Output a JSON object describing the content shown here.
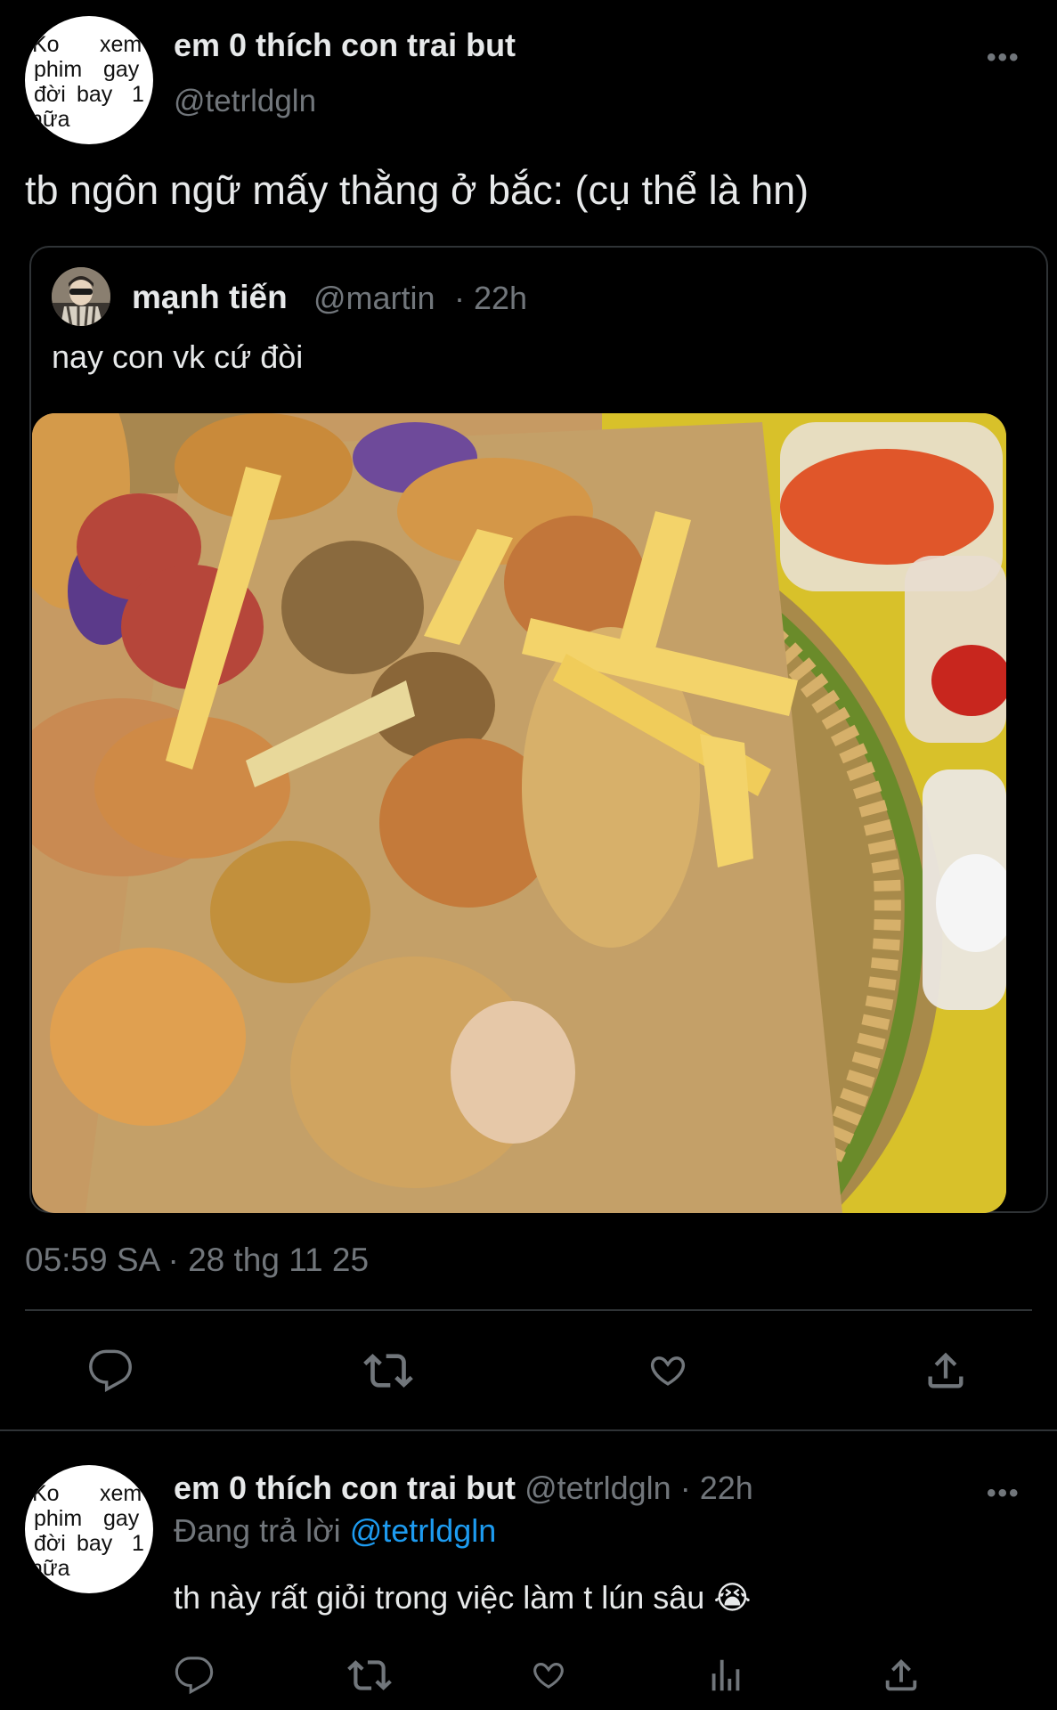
{
  "main_tweet": {
    "author_name": "em 0 thích con trai but",
    "author_handle": "@tetrldgln",
    "avatar_words": [
      "Ko",
      "xem",
      "phim",
      "gay",
      "đời",
      "bay",
      "1",
      "nữa"
    ],
    "more_label": "•••",
    "text": "tb ngôn ngữ mấy thằng ở bắc: (cụ thể là hn)",
    "timestamp": "05:59 SA · 28 thg 11 25"
  },
  "quoted_tweet": {
    "author_name": "mạnh tiến",
    "author_handle": "@martin",
    "time": "· 22h",
    "text": "nay con vk cứ đòi"
  },
  "actions": {
    "icons": [
      "reply-icon",
      "retweet-icon",
      "like-icon",
      "share-icon"
    ]
  },
  "reply_tweet": {
    "author_name": "em 0 thích con trai but",
    "author_handle": "@tetrldgln",
    "time": "· 22h",
    "more_label": "•••",
    "replying_prefix": "Đang trả lời",
    "replying_to": "@tetrldgln",
    "text": "th này rất giỏi trong việc làm t lún sâu",
    "emoji": "😭",
    "icons": [
      "reply-icon",
      "retweet-icon",
      "like-icon",
      "analytics-icon",
      "share-icon"
    ]
  },
  "colors": {
    "background": "#000000",
    "text": "#e7e9ea",
    "muted": "#71767b",
    "link": "#1d9bf0",
    "divider": "#2f3336"
  }
}
